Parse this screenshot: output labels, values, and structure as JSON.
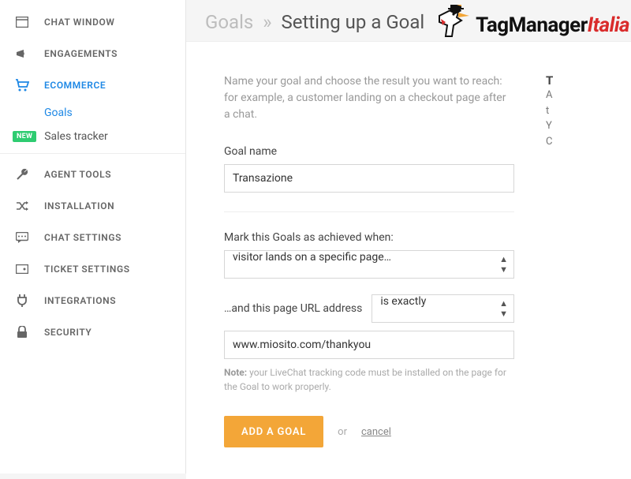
{
  "brand": {
    "part1": "TagManager",
    "part2": "Italia"
  },
  "breadcrumb": {
    "root": "Goals",
    "sep": "»",
    "current": "Setting up a Goal"
  },
  "sidebar": {
    "items": [
      {
        "label": "CHAT WINDOW"
      },
      {
        "label": "ENGAGEMENTS"
      },
      {
        "label": "ECOMMERCE"
      },
      {
        "label": "AGENT TOOLS"
      },
      {
        "label": "INSTALLATION"
      },
      {
        "label": "CHAT SETTINGS"
      },
      {
        "label": "TICKET SETTINGS"
      },
      {
        "label": "INTEGRATIONS"
      },
      {
        "label": "SECURITY"
      }
    ],
    "ecommerce_children": [
      {
        "label": "Goals"
      },
      {
        "label": "Sales tracker",
        "badge": "NEW"
      }
    ]
  },
  "form": {
    "description": "Name your goal and choose the result you want to reach: for example, a customer landing on a checkout page after a chat.",
    "goal_name_label": "Goal name",
    "goal_name_value": "Transazione",
    "achieved_label": "Mark this Goals as achieved when:",
    "achieved_value": "visitor lands on a specific page…",
    "url_prefix_label": "…and this page URL address",
    "url_match_value": "is exactly",
    "url_value": "www.miosito.com/thankyou",
    "note_strong": "Note:",
    "note_text": " your LiveChat tracking code must be installed on the page for the Goal to work properly.",
    "submit_label": "ADD A GOAL",
    "or_text": "or",
    "cancel_label": "cancel"
  },
  "tip": {
    "title": "T",
    "line1": "A",
    "line2": "t",
    "line3": "Y",
    "line4": "C"
  }
}
